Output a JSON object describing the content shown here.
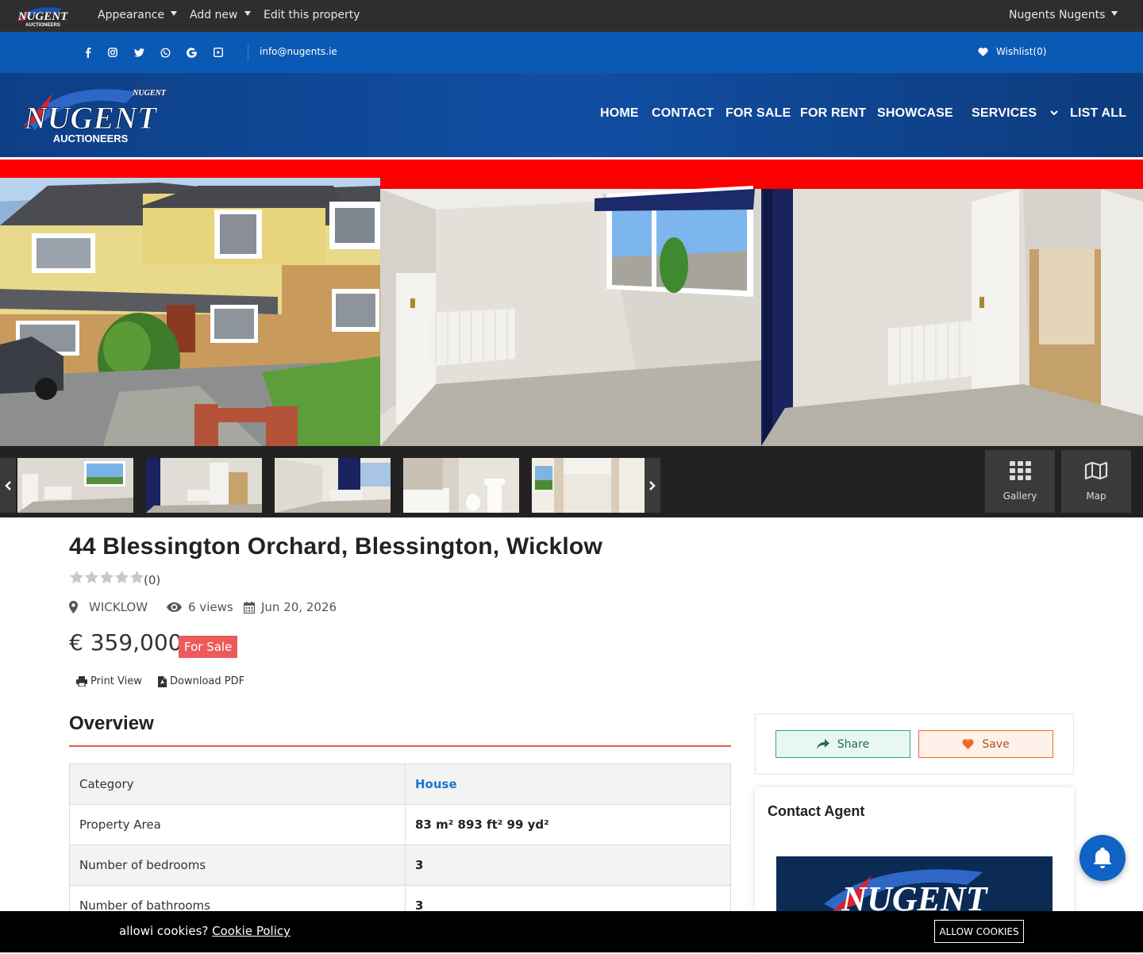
{
  "admin_bar": {
    "logo_text": "NUGENT",
    "logo_sub": "AUCTIONEERS",
    "appearance": "Appearance",
    "add_new": "Add new",
    "edit": "Edit this property",
    "user": "Nugents Nugents"
  },
  "topbar": {
    "social_icons": [
      "facebook-icon",
      "instagram-icon",
      "twitter-icon",
      "whatsapp-icon",
      "google-icon",
      "youtube-icon"
    ],
    "email": "info@nugents.ie",
    "wishlist": "Wishlist(0)"
  },
  "header": {
    "logo_text": "NUGENT",
    "logo_sub": "AUCTIONEERS",
    "logo_badge": "NUGENT",
    "nav": {
      "home": "HOME",
      "contact": "CONTACT",
      "for_sale": "FOR SALE",
      "for_rent": "FOR RENT",
      "showcase": "SHOWCASE",
      "services": "SERVICES",
      "list_all": "LIST ALL"
    }
  },
  "gallery": {
    "gallery_label": "Gallery",
    "map_label": "Map"
  },
  "property": {
    "title": "44 Blessington Orchard, Blessington, Wicklow",
    "rating_count": "(0)",
    "rating": 0,
    "location": "WICKLOW",
    "views": "6 views",
    "date": "Jun 20, 2026",
    "price": "€ 359,000",
    "status": "For Sale",
    "print": "Print View",
    "pdf": "Download PDF"
  },
  "overview": {
    "heading": "Overview",
    "rows": [
      {
        "label": "Category",
        "value": "House"
      },
      {
        "label": "Property Area",
        "value": "83 m² 893 ft² 99 yd²"
      },
      {
        "label": "Number of bedrooms",
        "value": "3"
      },
      {
        "label": "Number of bathrooms",
        "value": "3"
      }
    ]
  },
  "sidebar": {
    "share": "Share",
    "save": "Save",
    "contact_heading": "Contact Agent",
    "agent_logo_text": "NUGENT"
  },
  "cookie": {
    "text": "allowi cookies?",
    "link": "Cookie Policy",
    "button": "ALLOW COOKIES"
  },
  "colors": {
    "brand_blue": "#0a59b5",
    "brand_red": "#fb0000",
    "sale_badge": "#ec5a5a",
    "accent_line": "#e25b4b"
  }
}
